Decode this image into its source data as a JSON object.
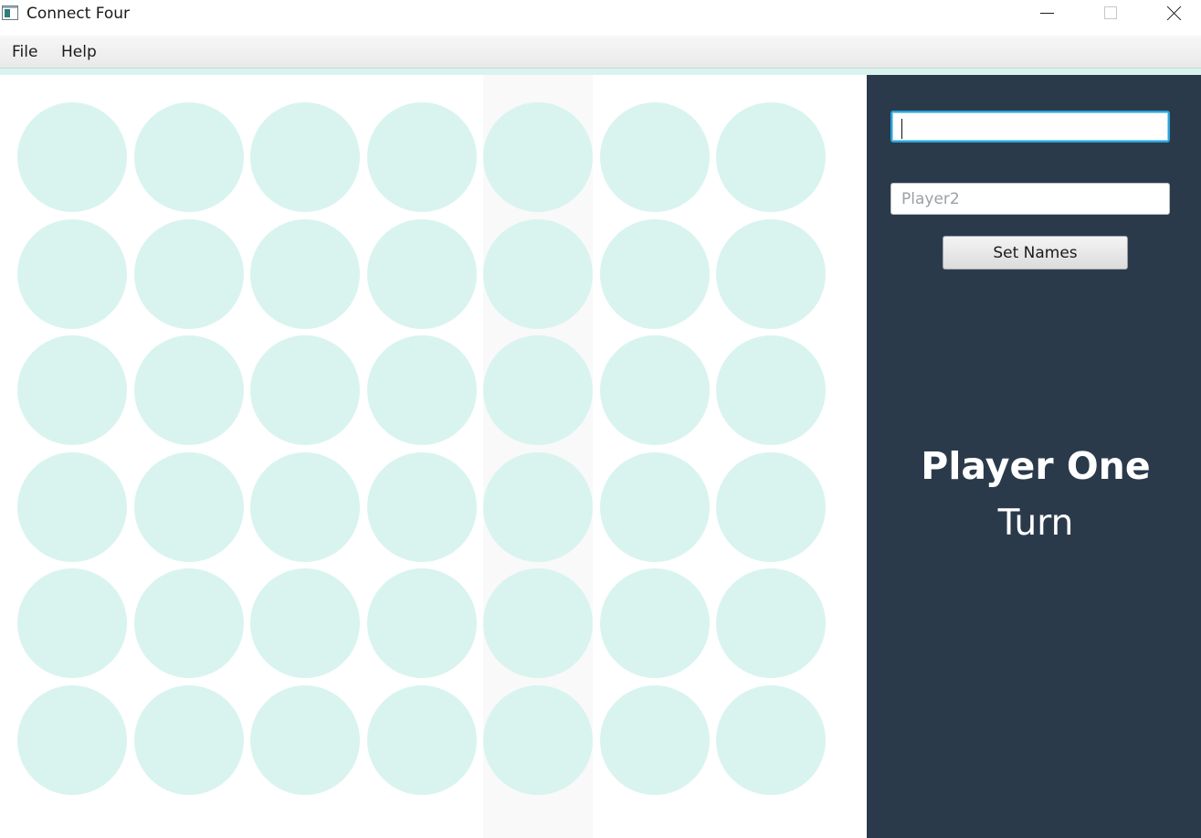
{
  "window": {
    "title": "Connect Four",
    "icon": "app-window-icon"
  },
  "menu": {
    "items": [
      "File",
      "Help"
    ]
  },
  "board": {
    "rows": 6,
    "columns": 7,
    "highlighted_column": 5,
    "empty_cell_color": "#d9f4ef"
  },
  "side_panel": {
    "background": "#2b3a4b",
    "player1_input": {
      "value": "",
      "placeholder": ""
    },
    "player2_input": {
      "value": "",
      "placeholder": "Player2"
    },
    "set_names_label": "Set Names",
    "turn_player": "Player One",
    "turn_label": "Turn"
  }
}
